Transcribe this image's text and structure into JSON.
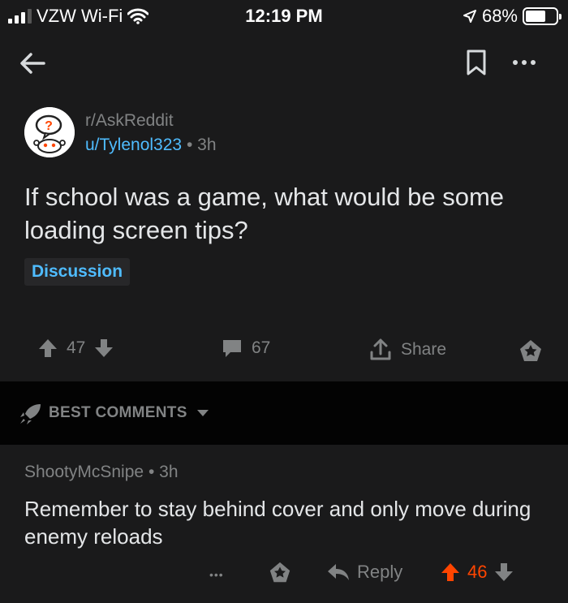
{
  "status": {
    "carrier": "VZW Wi-Fi",
    "time": "12:19 PM",
    "battery": "68%",
    "battery_level": 0.68
  },
  "post": {
    "subreddit": "r/AskReddit",
    "author": "u/Tylenol323",
    "separator": "•",
    "age": "3h",
    "title": "If school was a game, what would be some loading screen tips?",
    "flair": "Discussion",
    "score": "47",
    "comments": "67",
    "share_label": "Share"
  },
  "comments_sort": {
    "label": "BEST COMMENTS"
  },
  "comment": {
    "author": "ShootyMcSnipe",
    "separator": "•",
    "age": "3h",
    "body": "Remember to stay behind cover and only move during enemy reloads",
    "more": "•••",
    "reply_label": "Reply",
    "score": "46"
  },
  "colors": {
    "background": "#1a1a1b",
    "link_blue": "#4fbcff",
    "upvote_orange": "#ff4500",
    "muted_text": "#818384"
  }
}
